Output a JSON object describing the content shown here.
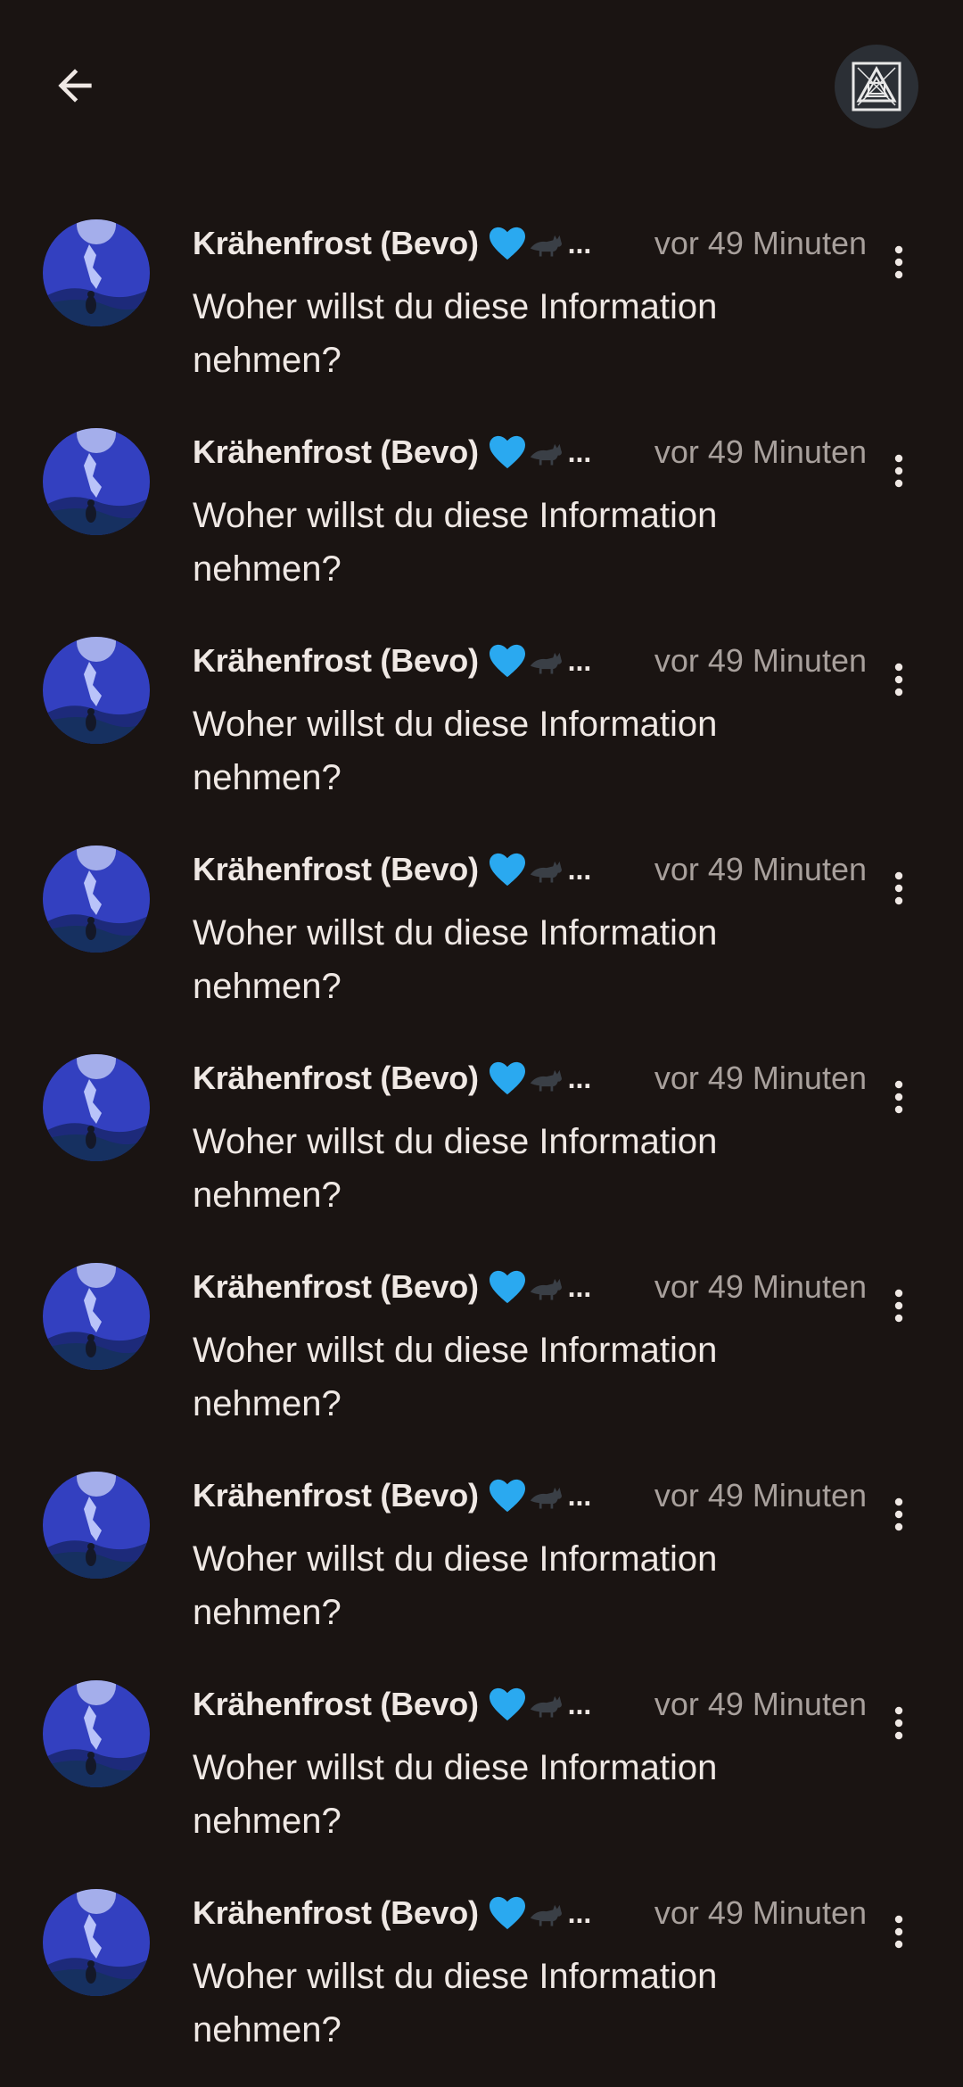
{
  "header": {
    "back_icon": "arrow-left-icon",
    "profile_icon": "profile-logo-icon"
  },
  "replies": [
    {
      "author": "Krähenfrost (Bevo)",
      "emoji": [
        "blue-heart",
        "black-cat"
      ],
      "ellipsis": "...",
      "time": "vor 49 Minuten",
      "text": "Woher willst du diese Information nehmen?"
    },
    {
      "author": "Krähenfrost (Bevo)",
      "emoji": [
        "blue-heart",
        "black-cat"
      ],
      "ellipsis": "...",
      "time": "vor 49 Minuten",
      "text": "Woher willst du diese Information nehmen?"
    },
    {
      "author": "Krähenfrost (Bevo)",
      "emoji": [
        "blue-heart",
        "black-cat"
      ],
      "ellipsis": "...",
      "time": "vor 49 Minuten",
      "text": "Woher willst du diese Information nehmen?"
    },
    {
      "author": "Krähenfrost (Bevo)",
      "emoji": [
        "blue-heart",
        "black-cat"
      ],
      "ellipsis": "...",
      "time": "vor 49 Minuten",
      "text": "Woher willst du diese Information nehmen?"
    },
    {
      "author": "Krähenfrost (Bevo)",
      "emoji": [
        "blue-heart",
        "black-cat"
      ],
      "ellipsis": "...",
      "time": "vor 49 Minuten",
      "text": "Woher willst du diese Information nehmen?"
    },
    {
      "author": "Krähenfrost (Bevo)",
      "emoji": [
        "blue-heart",
        "black-cat"
      ],
      "ellipsis": "...",
      "time": "vor 49 Minuten",
      "text": "Woher willst du diese Information nehmen?"
    },
    {
      "author": "Krähenfrost (Bevo)",
      "emoji": [
        "blue-heart",
        "black-cat"
      ],
      "ellipsis": "...",
      "time": "vor 49 Minuten",
      "text": "Woher willst du diese Information nehmen?"
    },
    {
      "author": "Krähenfrost (Bevo)",
      "emoji": [
        "blue-heart",
        "black-cat"
      ],
      "ellipsis": "...",
      "time": "vor 49 Minuten",
      "text": "Woher willst du diese Information nehmen?"
    },
    {
      "author": "Krähenfrost (Bevo)",
      "emoji": [
        "blue-heart",
        "black-cat"
      ],
      "ellipsis": "...",
      "time": "vor 49 Minuten",
      "text": "Woher willst du diese Information nehmen?"
    }
  ],
  "colors": {
    "background": "#1a1412",
    "primary_text": "#efe8e4",
    "secondary_text": "#a8a09c",
    "avatar_blue": "#3340c0",
    "heart_blue": "#2aa9f0"
  }
}
